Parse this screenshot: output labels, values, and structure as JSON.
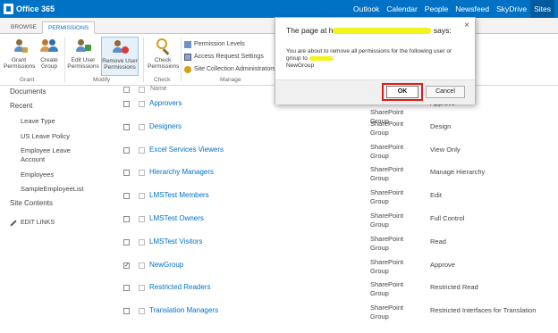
{
  "suitebar": {
    "brand": "Office 365",
    "links": [
      "Outlook",
      "Calendar",
      "People",
      "Newsfeed",
      "SkyDrive",
      "Sites"
    ],
    "active_link": "Sites",
    "color": "#0072c6"
  },
  "ribbon": {
    "tabs": [
      "BROWSE",
      "PERMISSIONS"
    ],
    "active_tab": "PERMISSIONS",
    "buttons": {
      "grant_permissions": "Grant Permissions",
      "create_group": "Create Group",
      "edit_user_permissions": "Edit User Permissions",
      "remove_user_permissions": "Remove User Permissions",
      "check_permissions": "Check Permissions",
      "permission_levels": "Permission Levels",
      "access_request_settings": "Access Request Settings",
      "site_collection_admins": "Site Collection Administrators"
    },
    "groups": {
      "grant": "Grant",
      "modify": "Modify",
      "check": "Check",
      "manage": "Manage"
    }
  },
  "leftnav": {
    "documents": "Documents",
    "recent": "Recent",
    "recent_items": [
      "Leave Type",
      "US Leave Policy",
      "Employee Leave Account",
      "Employees",
      "SampleEmployeeList"
    ],
    "site_contents": "Site Contents",
    "edit_links": "EDIT LINKS"
  },
  "list": {
    "header_name": "Name",
    "rows": [
      {
        "name": "Approvers",
        "type": "SharePoint Group",
        "permission": "Approve",
        "checked": false
      },
      {
        "name": "Designers",
        "type": "SharePoint Group",
        "permission": "Design",
        "checked": false
      },
      {
        "name": "Excel Services Viewers",
        "type": "SharePoint Group",
        "permission": "View Only",
        "checked": false
      },
      {
        "name": "Hierarchy Managers",
        "type": "SharePoint Group",
        "permission": "Manage Hierarchy",
        "checked": false
      },
      {
        "name": "LMSTest Members",
        "type": "SharePoint Group",
        "permission": "Edit",
        "checked": false
      },
      {
        "name": "LMSTest Owners",
        "type": "SharePoint Group",
        "permission": "Full Control",
        "checked": false
      },
      {
        "name": "LMSTest Visitors",
        "type": "SharePoint Group",
        "permission": "Read",
        "checked": false
      },
      {
        "name": "NewGroup",
        "type": "SharePoint Group",
        "permission": "Approve",
        "checked": true
      },
      {
        "name": "Restricted Readers",
        "type": "SharePoint Group",
        "permission": "Restricted Read",
        "checked": false
      },
      {
        "name": "Translation Managers",
        "type": "SharePoint Group",
        "permission": "Restricted Interfaces for Translation",
        "checked": false
      }
    ]
  },
  "dialog": {
    "title_prefix": "The page at h",
    "title_suffix": "says:",
    "message_line1": "You are about to remove all permissions for the following user or",
    "message_line2_prefix": "group to",
    "message_line3": "NewGroup",
    "ok_label": "OK",
    "cancel_label": "Cancel",
    "close_glyph": "×",
    "highlight_color": "#e01b1b",
    "redaction_color": "#f3f31d"
  },
  "icons": [
    "office-logo-icon",
    "grant-permissions-icon",
    "create-group-icon",
    "edit-user-permissions-icon",
    "remove-user-permissions-icon",
    "check-permissions-icon",
    "permission-levels-icon",
    "access-request-icon",
    "site-collection-admins-icon",
    "pencil-icon",
    "close-icon"
  ]
}
